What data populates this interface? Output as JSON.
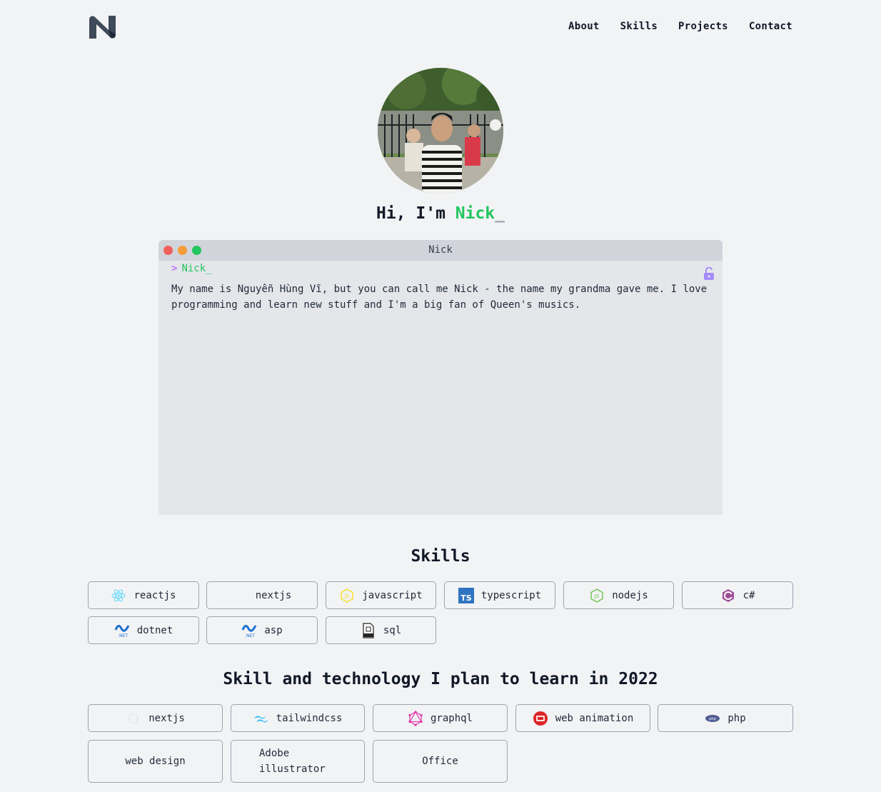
{
  "nav": {
    "logo_name": "n-logo",
    "links": [
      "About",
      "Skills",
      "Projects",
      "Contact"
    ]
  },
  "hero": {
    "greeting_prefix": "Hi, I'm ",
    "greeting_name": "Nick",
    "greeting_cursor": "_"
  },
  "terminal": {
    "title": "Nick",
    "prompt_symbol": ">",
    "prompt_text": "Nick_",
    "bio": "My name is Nguyễn Hùng Vĩ, but you can call me Nick - the name my grandma gave me. I love programming and learn new stuff and I'm a big fan of Queen's musics."
  },
  "skills": {
    "title": "Skills",
    "items": [
      {
        "label": "reactjs",
        "icon": "react-icon"
      },
      {
        "label": "nextjs",
        "icon": ""
      },
      {
        "label": "javascript",
        "icon": "javascript-icon"
      },
      {
        "label": "typescript",
        "icon": "typescript-icon"
      },
      {
        "label": "nodejs",
        "icon": "nodejs-icon"
      },
      {
        "label": "c#",
        "icon": "csharp-icon"
      },
      {
        "label": "dotnet",
        "icon": "dotnet-icon"
      },
      {
        "label": "asp",
        "icon": "dotnet-icon"
      },
      {
        "label": "sql",
        "icon": "sql-file-icon"
      }
    ]
  },
  "learn": {
    "title": "Skill and technology I plan to learn in 2022",
    "items": [
      {
        "label": "nextjs",
        "icon": "nextjs-icon"
      },
      {
        "label": "tailwindcss",
        "icon": "tailwind-icon"
      },
      {
        "label": "graphql",
        "icon": "graphql-icon"
      },
      {
        "label": "web animation",
        "icon": "web-animation-icon"
      },
      {
        "label": "php",
        "icon": "php-icon"
      },
      {
        "label": "web design",
        "icon": ""
      },
      {
        "label": "Adobe illustrator",
        "icon": ""
      },
      {
        "label": "Office",
        "icon": ""
      }
    ]
  },
  "colors": {
    "accent_green": "#22c55e",
    "prompt_purple": "#a855f7",
    "background": "#f2f3f5"
  }
}
